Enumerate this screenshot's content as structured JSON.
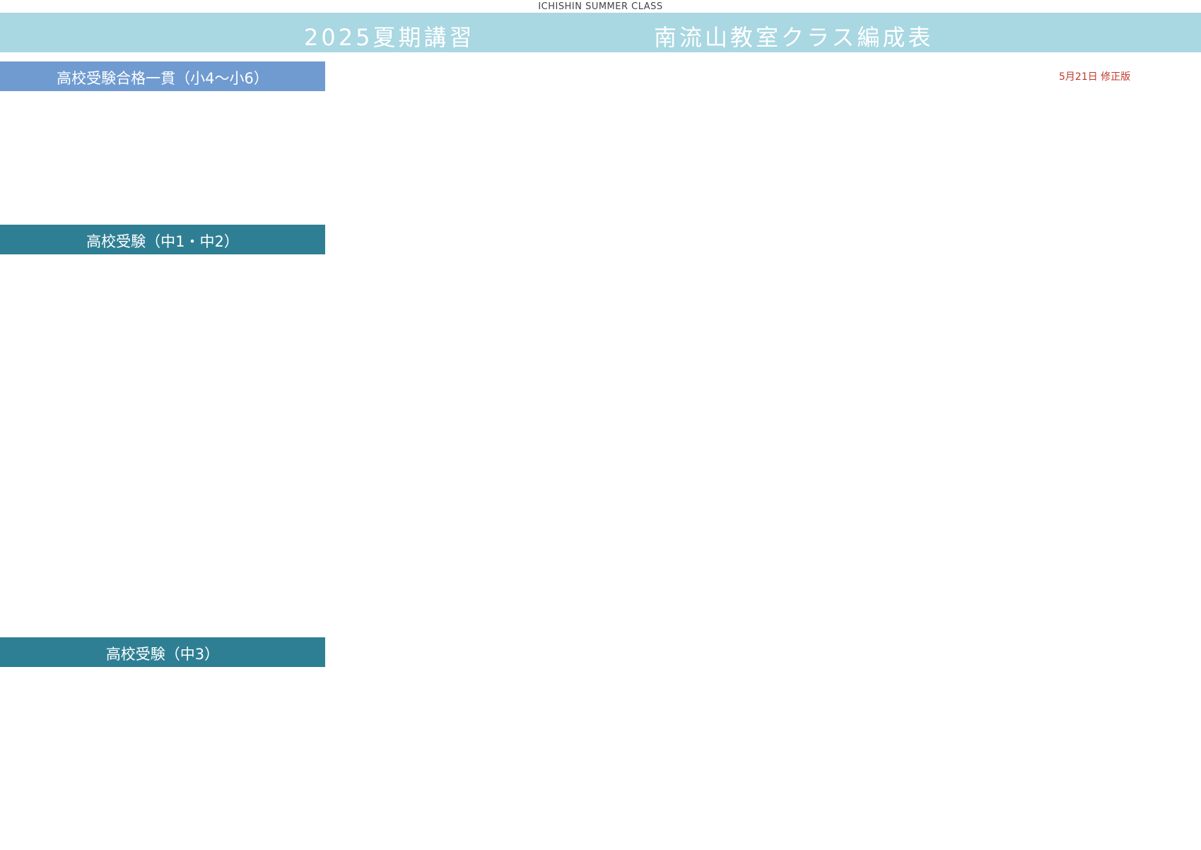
{
  "header": {
    "caption": "ICHISHIN SUMMER CLASS",
    "title_left": "2025夏期講習",
    "title_right": "南流山教室クラス編成表",
    "revision_note": "5月21日 修正版"
  },
  "sections": {
    "elementary": {
      "title": "高校受験合格一貫（小4～小6）"
    },
    "junior_1_2": {
      "title": "高校受験（中1・中2）"
    },
    "junior_3": {
      "title": "高校受験（中3）"
    }
  },
  "colors": {
    "banner": "#a9d7e2",
    "section_elementary": "#6f9bd1",
    "section_junior": "#2f7f94",
    "revision_note": "#c0392b"
  }
}
